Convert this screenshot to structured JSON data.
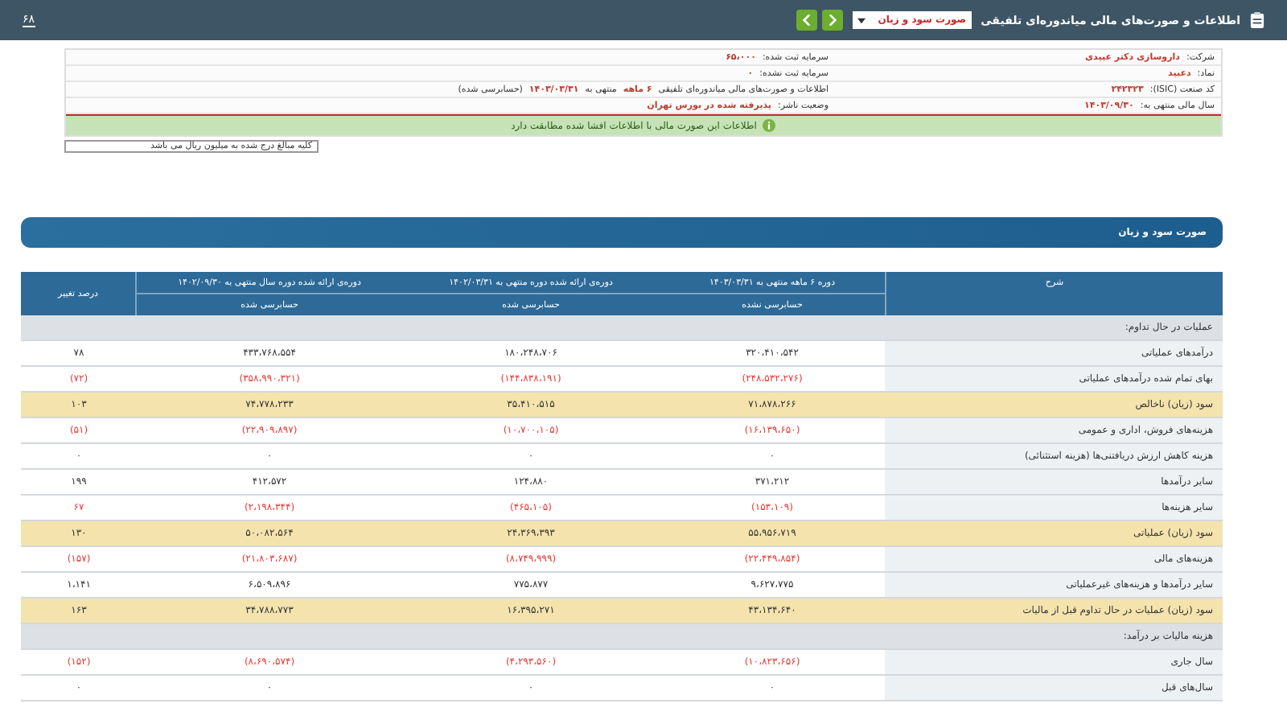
{
  "top_bar": {
    "title": "اطلاعات و صورت‌های مالی میاندوره‌ای تلفیقی",
    "report_select": {
      "value": "صورت سود و زیان"
    },
    "counter": "۶۸"
  },
  "info": {
    "rows": [
      {
        "right": {
          "label": "شرکت:",
          "value": "داروسازی دکتر عبیدی"
        },
        "left": {
          "label": "سرمایه ثبت شده:",
          "value": "۶۵،۰۰۰"
        }
      },
      {
        "right": {
          "label": "نماد:",
          "value": "دعبید"
        },
        "left": {
          "label": "سرمایه ثبت نشده:",
          "value": "۰"
        }
      },
      {
        "right": {
          "label": "کد صنعت (ISIC):",
          "value": "۲۴۲۳۲۳"
        },
        "left": {
          "label": "اطلاعات و صورت‌های مالی میاندوره‌ای تلفیقی",
          "value": "۶ ماهه",
          "extra": [
            "منتهی به",
            "۱۴۰۳/۰۳/۳۱",
            "(حسابرسی شده)"
          ]
        }
      },
      {
        "right": {
          "label": "سال مالی منتهی به:",
          "value": "۱۴۰۳/۰۹/۳۰"
        },
        "left": {
          "label": "وضعیت ناشر:",
          "value": "پذیرفته شده در بورس تهران"
        }
      }
    ],
    "notice": "اطلاعات این صورت مالی با اطلاعات افشا شده مطابقت دارد",
    "unit_note": "کلیه مبالغ درج شده به میلیون ریال می باشد"
  },
  "section_title": "صورت سود و زیان",
  "table": {
    "columns": [
      {
        "title": "شرح"
      },
      {
        "title": "دوره ۶ ماهه منتهی به ۱۴۰۳/۰۳/۳۱",
        "sub": "حسابرسی نشده"
      },
      {
        "title": "دوره‌ی ارائه شده دوره منتهی به ۱۴۰۲/۰۳/۳۱",
        "sub": "حسابرسی شده"
      },
      {
        "title": "دوره‌ی ارائه شده دوره سال منتهی به ۱۴۰۲/۰۹/۳۰",
        "sub": "حسابرسی شده"
      },
      {
        "title": "درصد تغییر"
      }
    ],
    "rows": [
      {
        "kind": "section",
        "label": "عملیات در حال تداوم:"
      },
      {
        "kind": "item",
        "label": "درآمدهای عملیاتی",
        "negative": false,
        "values": [
          "۳۲۰،۴۱۰،۵۴۲",
          "۱۸۰،۲۴۸،۷۰۶",
          "۴۳۳،۷۶۸،۵۵۴",
          "۷۸"
        ]
      },
      {
        "kind": "item",
        "label": "بهای تمام شده درآمدهای عملیاتی",
        "negative": true,
        "values": [
          "(۲۴۸،۵۳۲،۲۷۶)",
          "(۱۴۴،۸۳۸،۱۹۱)",
          "(۳۵۸،۹۹۰،۳۲۱)",
          "(۷۲)"
        ]
      },
      {
        "kind": "total",
        "label": "سود (زیان) ناخالص",
        "negative": false,
        "values": [
          "۷۱،۸۷۸،۲۶۶",
          "۳۵،۴۱۰،۵۱۵",
          "۷۴،۷۷۸،۲۳۳",
          "۱۰۳"
        ]
      },
      {
        "kind": "item",
        "label": "هزینه‌های فروش، اداری و عمومی",
        "negative": true,
        "values": [
          "(۱۶،۱۳۹،۶۵۰)",
          "(۱۰،۷۰۰،۱۰۵)",
          "(۲۲،۹۰۹،۸۹۷)",
          "(۵۱)"
        ]
      },
      {
        "kind": "item",
        "label": "هزینه کاهش ارزش دریافتنی‌ها (هزینه استثنائی)",
        "negative": false,
        "values": [
          "۰",
          "۰",
          "۰",
          "۰"
        ]
      },
      {
        "kind": "item",
        "label": "سایر درآمدها",
        "negative": false,
        "values": [
          "۳۷۱،۲۱۲",
          "۱۲۴،۸۸۰",
          "۴۱۲،۵۷۲",
          "۱۹۹"
        ]
      },
      {
        "kind": "item",
        "label": "سایر هزینه‌ها",
        "negative": true,
        "values": [
          "(۱۵۳،۱۰۹)",
          "(۴۶۵،۱۰۵)",
          "(۲،۱۹۸،۳۴۴)",
          "۶۷"
        ]
      },
      {
        "kind": "total",
        "label": "سود (زیان) عملیاتی",
        "negative": false,
        "values": [
          "۵۵،۹۵۶،۷۱۹",
          "۲۴،۳۶۹،۳۹۳",
          "۵۰،۰۸۲،۵۶۴",
          "۱۳۰"
        ]
      },
      {
        "kind": "item",
        "label": "هزینه‌های مالی",
        "negative": true,
        "values": [
          "(۲۲،۴۴۹،۸۵۴)",
          "(۸،۷۴۹،۹۹۹)",
          "(۲۱،۸۰۳،۶۸۷)",
          "(۱۵۷)"
        ]
      },
      {
        "kind": "item",
        "label": "سایر درآمدها و هزینه‌های غیرعملیاتی",
        "negative": false,
        "values": [
          "۹،۶۲۷،۷۷۵",
          "۷۷۵،۸۷۷",
          "۶،۵۰۹،۸۹۶",
          "۱،۱۴۱"
        ]
      },
      {
        "kind": "total",
        "label": "سود (زیان) عملیات در حال تداوم قبل از مالیات",
        "negative": false,
        "values": [
          "۴۳،۱۳۴،۶۴۰",
          "۱۶،۳۹۵،۲۷۱",
          "۳۴،۷۸۸،۷۷۳",
          "۱۶۳"
        ]
      },
      {
        "kind": "section",
        "label": "هزینه مالیات بر درآمد:"
      },
      {
        "kind": "item",
        "label": "سال جاری",
        "negative": true,
        "values": [
          "(۱۰،۸۲۳،۶۵۶)",
          "(۴،۲۹۳،۵۶۰)",
          "(۸،۶۹۰،۵۷۴)",
          "(۱۵۲)"
        ]
      },
      {
        "kind": "item",
        "label": "سال‌های قبل",
        "negative": false,
        "values": [
          "۰",
          "۰",
          "۰",
          "۰"
        ]
      }
    ]
  }
}
